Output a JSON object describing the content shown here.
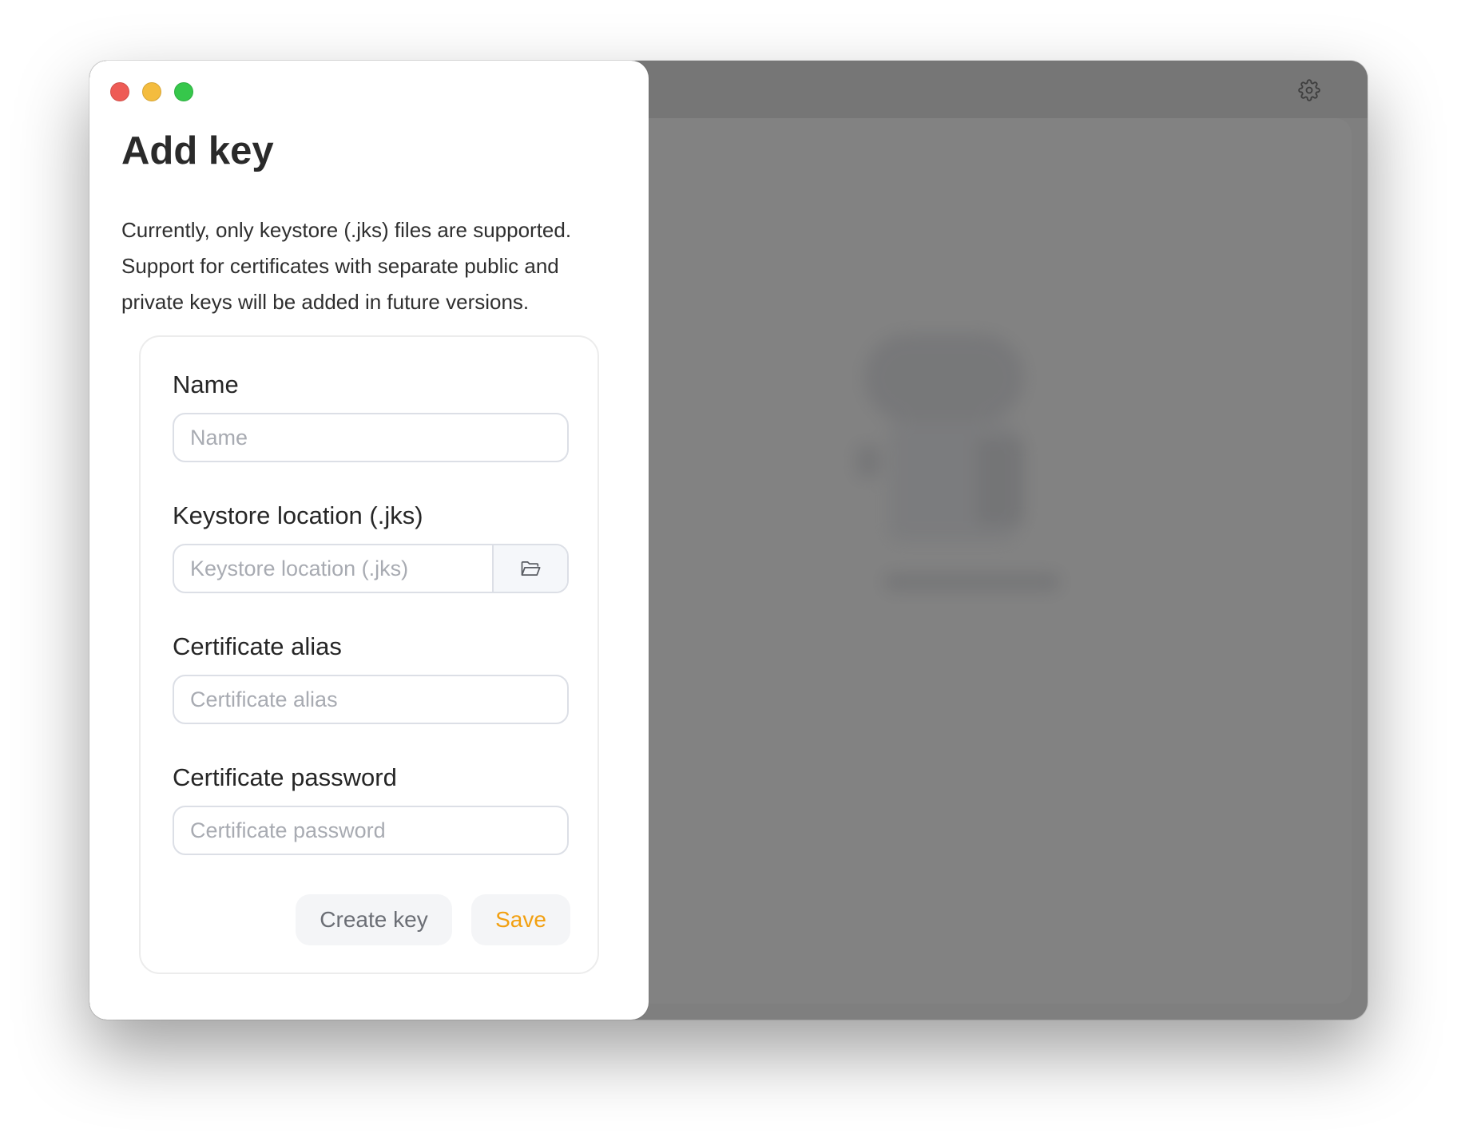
{
  "background": {
    "settings_icon": "gear-icon"
  },
  "dialog": {
    "title": "Add key",
    "description": "Currently, only keystore (.jks) files are supported. Support for certificates with separate public and private keys will be added in future versions.",
    "fields": {
      "name": {
        "label": "Name",
        "placeholder": "Name",
        "value": ""
      },
      "keystore": {
        "label": "Keystore location (.jks)",
        "placeholder": "Keystore location (.jks)",
        "value": "",
        "browse_icon": "folder-open-icon"
      },
      "alias": {
        "label": "Certificate alias",
        "placeholder": "Certificate alias",
        "value": ""
      },
      "password": {
        "label": "Certificate password",
        "placeholder": "Certificate password",
        "value": ""
      }
    },
    "buttons": {
      "create_key": "Create key",
      "save": "Save"
    }
  },
  "colors": {
    "accent": "#f2a011",
    "traffic_close": "#ee5b55",
    "traffic_minimize": "#f4bc3e",
    "traffic_maximize": "#36c74b"
  }
}
